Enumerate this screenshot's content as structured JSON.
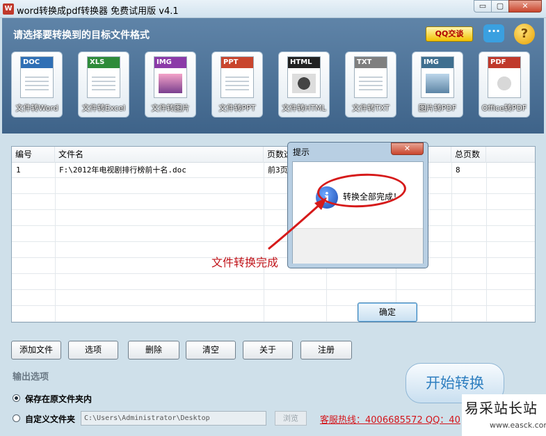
{
  "window": {
    "title": "word转换成pdf转换器 免费试用版 v4.1",
    "min": "▭",
    "max": "▢",
    "close": "✕"
  },
  "panel": {
    "heading": "请选择要转换到的目标文件格式",
    "qq_label": "QQ交谈",
    "chat_glyph": "···",
    "help_glyph": "?"
  },
  "tools": [
    {
      "tag": "DOC",
      "label": "文件转Word",
      "color": "#2f6fb5"
    },
    {
      "tag": "XLS",
      "label": "文件转Excel",
      "color": "#2e8b3a"
    },
    {
      "tag": "IMG",
      "label": "文件转图片",
      "color": "#8b3aa8"
    },
    {
      "tag": "PPT",
      "label": "文件转PPT",
      "color": "#c9452d"
    },
    {
      "tag": "HTML",
      "label": "文件转HTML",
      "color": "#222222"
    },
    {
      "tag": "TXT",
      "label": "文件转TXT",
      "color": "#7f7f7f"
    },
    {
      "tag": "IMG",
      "label": "图片转PDF",
      "color": "#3f6f8f"
    },
    {
      "tag": "PDF",
      "label": "Office转PDF",
      "color": "#c0392b"
    }
  ],
  "table": {
    "columns": [
      "编号",
      "文件名",
      "页数选",
      "",
      "",
      "总页数"
    ],
    "rows": [
      {
        "num": "1",
        "file": "F:\\2012年电视剧排行榜前十名.doc",
        "pages": "前3页",
        "total": "8"
      }
    ]
  },
  "dialog": {
    "title": "提示",
    "message": "转换全部完成！",
    "ok": "确定",
    "close": "✕",
    "icon_glyph": "i"
  },
  "annotation": {
    "text": "文件转换完成"
  },
  "buttons": {
    "add": "添加文件",
    "options": "选项",
    "delete": "删除",
    "clear": "清空",
    "about": "关于",
    "register": "注册"
  },
  "output": {
    "section": "输出选项",
    "opt_same": "保存在原文件夹内",
    "opt_custom": "自定义文件夹",
    "path": "C:\\Users\\Administrator\\Desktop",
    "browse": "浏览",
    "hotline": "客服热线：4006685572 QQ：40"
  },
  "start": "开始转换",
  "watermark": {
    "line1": "易采站长站",
    "line2": "www.easck.com"
  }
}
